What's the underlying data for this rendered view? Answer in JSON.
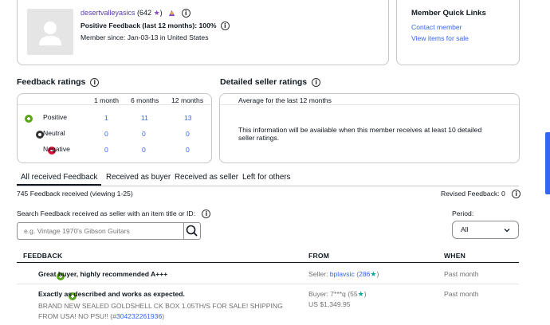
{
  "profile": {
    "username": "desertvalleyasics",
    "score_open": "(",
    "score": "642",
    "score_close": ")",
    "positive_feedback": "Positive Feedback (last 12 months): 100%",
    "member_since": "Member since: Jan-03-13 in United States"
  },
  "quick_links": {
    "title": "Member Quick Links",
    "contact": "Contact member",
    "view_items": "View items for sale"
  },
  "feedback_ratings": {
    "title": "Feedback ratings",
    "columns": [
      "1 month",
      "6 months",
      "12 months"
    ],
    "rows": [
      {
        "label": "Positive",
        "values": [
          "1",
          "11",
          "13"
        ]
      },
      {
        "label": "Neutral",
        "values": [
          "0",
          "0",
          "0"
        ]
      },
      {
        "label": "Negative",
        "values": [
          "0",
          "0",
          "0"
        ]
      }
    ]
  },
  "detailed_ratings": {
    "title": "Detailed seller ratings",
    "subtitle": "Average for the last 12 months",
    "message": "This information will be available when this member receives at least 10 detailed seller ratings."
  },
  "tabs": [
    "All received Feedback",
    "Received as buyer",
    "Received as seller",
    "Left for others"
  ],
  "summary": {
    "count_text": "745 Feedback received (viewing 1-25)",
    "revised": "Revised Feedback: 0"
  },
  "search": {
    "label": "Search Feedback received as seller with an item title or ID:",
    "placeholder": "e.g. Vintage 1970's Gibson Guitars"
  },
  "period": {
    "label": "Period:",
    "selected": "All"
  },
  "table": {
    "headers": [
      "FEEDBACK",
      "FROM",
      "WHEN"
    ],
    "rows": [
      {
        "comment": "Great buyer, highly recommended A+++",
        "from_prefix": "Seller: ",
        "from_user": "bplavsic",
        "from_score_open": " (",
        "from_score": "286",
        "from_score_close": ")",
        "when": "Past month"
      },
      {
        "comment": "Exactly as described and works as expected.",
        "item": "BRAND NEW SEALED GOLDSHELL CK BOX 1.05TH/S FOR SALE! SHIPPING FROM USA! NO PSU!! (#",
        "item_id": "304232261936",
        "item_close": ")",
        "from_prefix": "Buyer: ",
        "from_user": "7***q",
        "from_score_open": " (",
        "from_score": "55",
        "from_score_close": ")",
        "price": "US $1,349.95",
        "when": "Past month"
      }
    ]
  },
  "colors": {
    "link": "#3665f3",
    "positive": "#5ba71b",
    "negative": "#e0103a",
    "neutral": "#333333",
    "star_teal": "#0aa89e",
    "badge_purple": "#8a49c8"
  }
}
